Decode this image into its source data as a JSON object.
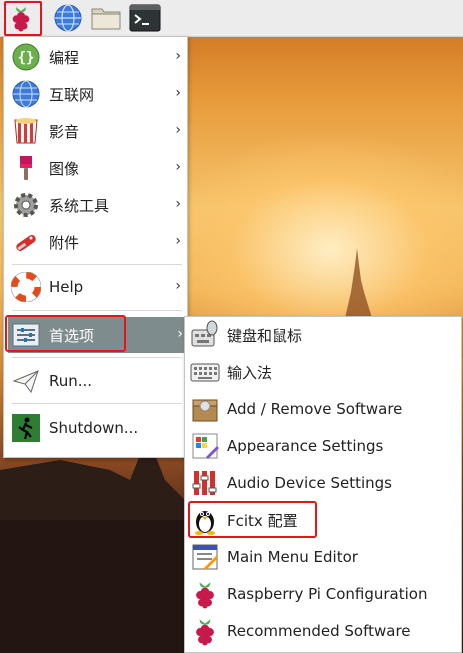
{
  "main_menu": {
    "items": [
      {
        "label": "编程",
        "icon": "programming-icon"
      },
      {
        "label": "互联网",
        "icon": "globe-icon"
      },
      {
        "label": "影音",
        "icon": "media-icon"
      },
      {
        "label": "图像",
        "icon": "paint-icon"
      },
      {
        "label": "系统工具",
        "icon": "gear-icon"
      },
      {
        "label": "附件",
        "icon": "accessories-icon"
      },
      {
        "label": "Help",
        "icon": "lifebuoy-icon"
      },
      {
        "label": "首选项",
        "icon": "preferences-icon"
      },
      {
        "label": "Run...",
        "icon": "paper-plane-icon"
      },
      {
        "label": "Shutdown...",
        "icon": "exit-icon"
      }
    ],
    "submenu_arrow": "›"
  },
  "preferences_submenu": {
    "items": [
      {
        "label": "键盘和鼠标",
        "icon": "keyboard-mouse-icon"
      },
      {
        "label": "输入法",
        "icon": "keyboard-icon"
      },
      {
        "label": "Add / Remove Software",
        "icon": "package-icon"
      },
      {
        "label": "Appearance Settings",
        "icon": "appearance-icon"
      },
      {
        "label": "Audio Device Settings",
        "icon": "audio-mixer-icon"
      },
      {
        "label": "Fcitx 配置",
        "icon": "tux-icon"
      },
      {
        "label": "Main Menu Editor",
        "icon": "menu-editor-icon"
      },
      {
        "label": "Raspberry Pi Configuration",
        "icon": "raspberry-icon"
      },
      {
        "label": "Recommended Software",
        "icon": "raspberry-icon"
      }
    ]
  },
  "colors": {
    "highlight_red": "#e4161b",
    "active_item_bg": "#7f8c8d",
    "raspberry_red": "#c51a4a"
  }
}
